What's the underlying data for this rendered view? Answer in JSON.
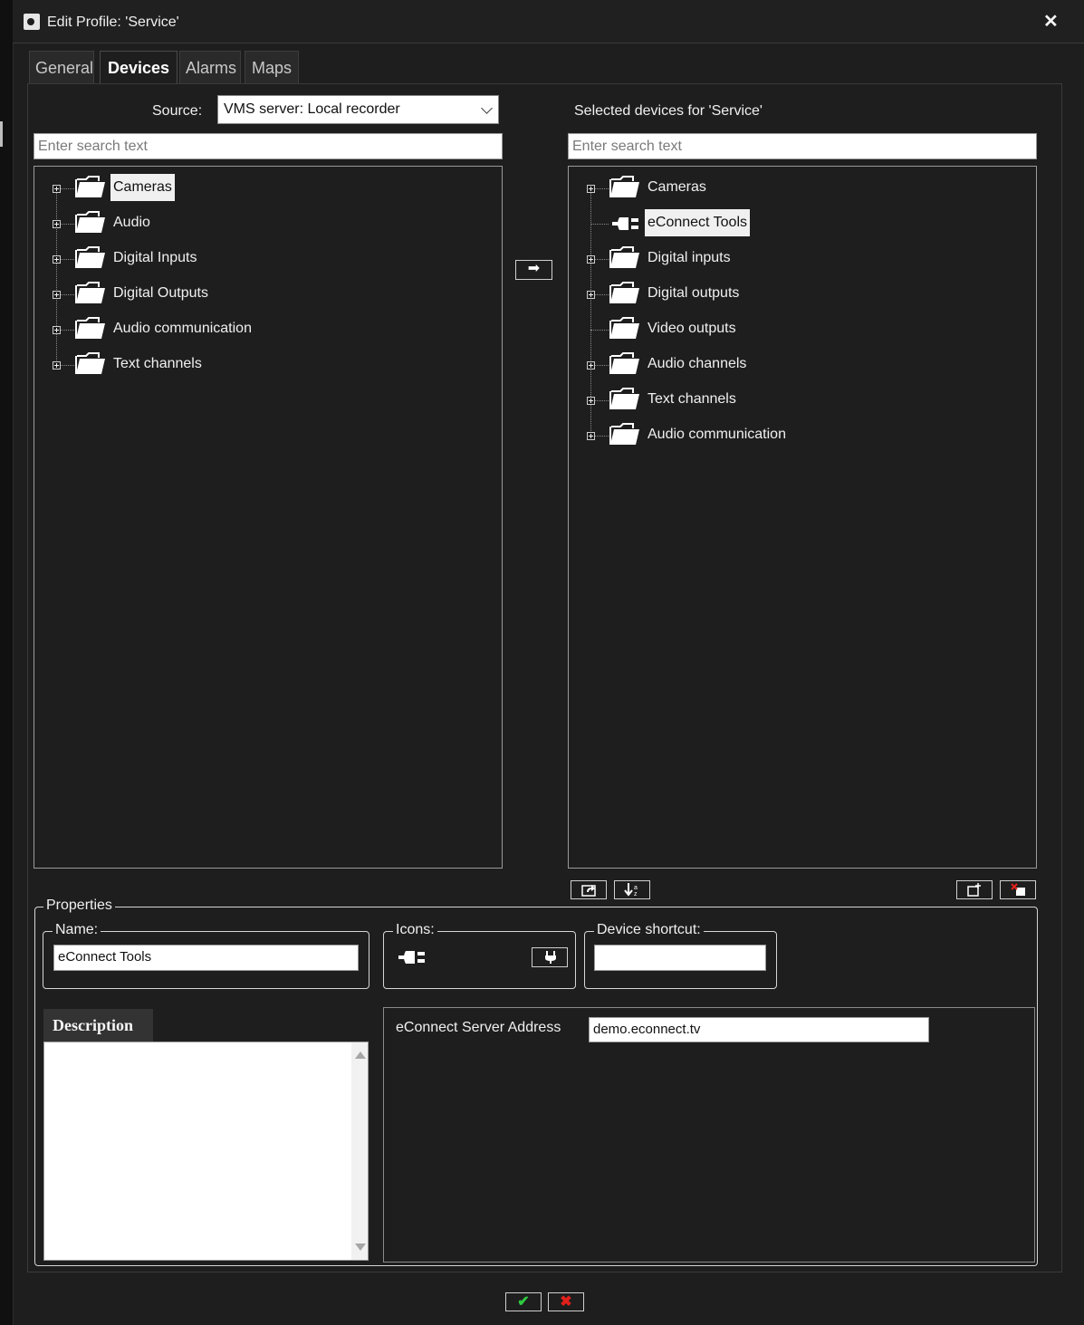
{
  "window": {
    "title": "Edit Profile: 'Service'",
    "close_icon": "close-icon"
  },
  "tabs": [
    {
      "label": "General",
      "active": false
    },
    {
      "label": "Devices",
      "active": true
    },
    {
      "label": "Alarms",
      "active": false
    },
    {
      "label": "Maps",
      "active": false
    }
  ],
  "source": {
    "label": "Source:",
    "selected": "VMS server: Local recorder"
  },
  "left_search": {
    "placeholder": "Enter search text"
  },
  "left_tree": [
    {
      "label": "Cameras",
      "selected": true,
      "expandable": true
    },
    {
      "label": "Audio",
      "selected": false,
      "expandable": true
    },
    {
      "label": "Digital Inputs",
      "selected": false,
      "expandable": true
    },
    {
      "label": "Digital Outputs",
      "selected": false,
      "expandable": true
    },
    {
      "label": "Audio communication",
      "selected": false,
      "expandable": true
    },
    {
      "label": "Text channels",
      "selected": false,
      "expandable": true
    }
  ],
  "transfer_button": {
    "icon": "arrow-right-icon"
  },
  "right_header": "Selected devices for 'Service'",
  "right_search": {
    "placeholder": "Enter search text"
  },
  "right_tree": [
    {
      "label": "Cameras",
      "selected": false,
      "expandable": true,
      "icon": "folder-icon"
    },
    {
      "label": "eConnect Tools",
      "selected": true,
      "expandable": false,
      "icon": "plug-icon",
      "child": true
    },
    {
      "label": "Digital inputs",
      "selected": false,
      "expandable": true,
      "icon": "folder-icon"
    },
    {
      "label": "Digital outputs",
      "selected": false,
      "expandable": true,
      "icon": "folder-icon"
    },
    {
      "label": "Video outputs",
      "selected": false,
      "expandable": false,
      "icon": "folder-icon"
    },
    {
      "label": "Audio channels",
      "selected": false,
      "expandable": true,
      "icon": "folder-icon"
    },
    {
      "label": "Text channels",
      "selected": false,
      "expandable": true,
      "icon": "folder-icon"
    },
    {
      "label": "Audio communication",
      "selected": false,
      "expandable": true,
      "icon": "folder-icon"
    }
  ],
  "properties": {
    "legend": "Properties",
    "name_legend": "Name:",
    "name_value": "eConnect Tools",
    "icons_legend": "Icons:",
    "shortcut_legend": "Device shortcut:",
    "shortcut_value": "",
    "description_tab": "Description",
    "description_value": "",
    "server_address_label": "eConnect Server Address",
    "server_address_value": "demo.econnect.tv"
  },
  "colors": {
    "background": "#1e1e1e",
    "ok": "#2ecc40",
    "cancel": "#e0201a"
  }
}
